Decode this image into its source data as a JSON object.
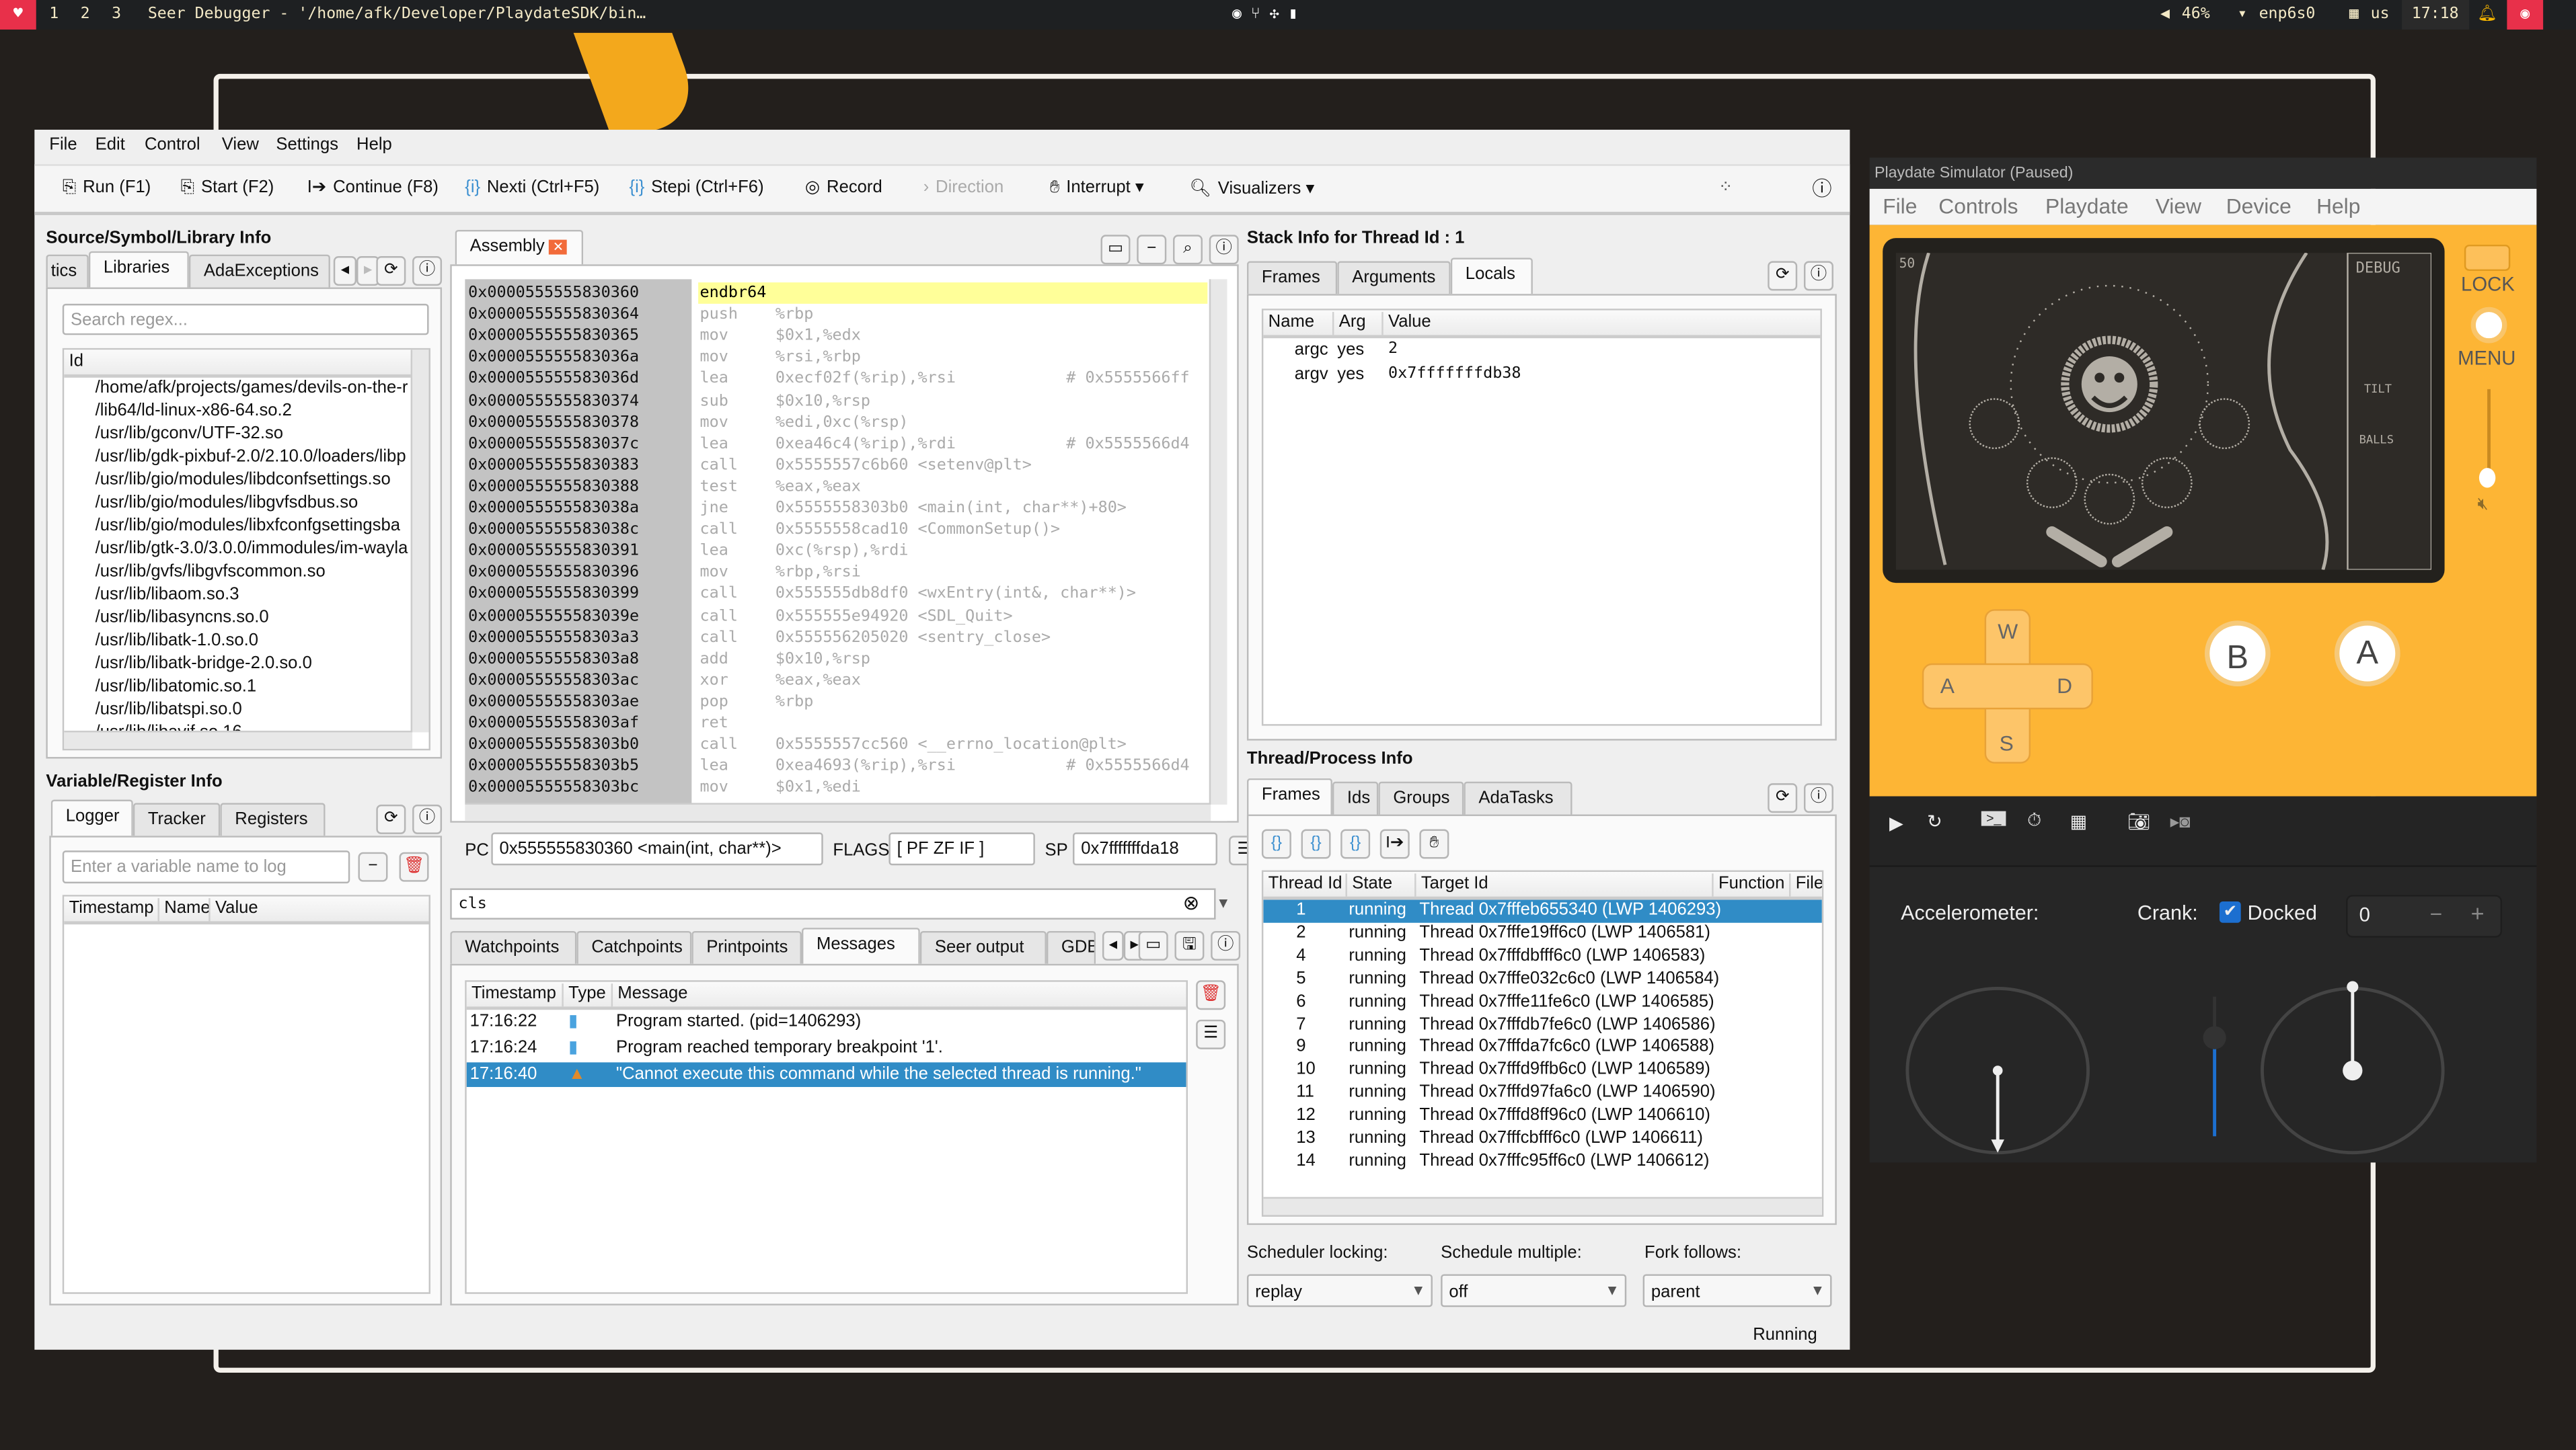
{
  "taskbar": {
    "workspaces": [
      "1",
      "2",
      "3"
    ],
    "window_title": "Seer Debugger - '/home/afk/Developer/PlaydateSDK/bin…",
    "volume": "46%",
    "network": "enp6s0",
    "keyboard_layout": "us",
    "clock": "17:18"
  },
  "seer": {
    "menu": [
      "File",
      "Edit",
      "Control",
      "View",
      "Settings",
      "Help"
    ],
    "toolbar": {
      "run": "Run (F1)",
      "start": "Start (F2)",
      "continue": "Continue (F8)",
      "nexti": "Nexti (Ctrl+F5)",
      "stepi": "Stepi (Ctrl+F6)",
      "record": "Record",
      "direction": "Direction",
      "interrupt": "Interrupt",
      "visualizers": "Visualizers"
    },
    "source_panel": {
      "title": "Source/Symbol/Library Info",
      "tabs": [
        "tics",
        "Libraries",
        "AdaExceptions"
      ],
      "active_tab": "Libraries",
      "search_placeholder": "Search regex...",
      "column": "Id",
      "libraries": [
        "/home/afk/projects/games/devils-on-the-r",
        "/lib64/ld-linux-x86-64.so.2",
        "/usr/lib/gconv/UTF-32.so",
        "/usr/lib/gdk-pixbuf-2.0/2.10.0/loaders/libp",
        "/usr/lib/gio/modules/libdconfsettings.so",
        "/usr/lib/gio/modules/libgvfsdbus.so",
        "/usr/lib/gio/modules/libxfconfgsettingsba",
        "/usr/lib/gtk-3.0/3.0.0/immodules/im-wayla",
        "/usr/lib/gvfs/libgvfscommon.so",
        "/usr/lib/libaom.so.3",
        "/usr/lib/libasyncns.so.0",
        "/usr/lib/libatk-1.0.so.0",
        "/usr/lib/libatk-bridge-2.0.so.0",
        "/usr/lib/libatomic.so.1",
        "/usr/lib/libatspi.so.0",
        "/usr/lib/libavif.so.16"
      ]
    },
    "variable_panel": {
      "title": "Variable/Register Info",
      "tabs": [
        "Logger",
        "Tracker",
        "Registers"
      ],
      "active_tab": "Logger",
      "input_placeholder": "Enter a variable name to log",
      "columns": [
        "Timestamp",
        "Name",
        "Value"
      ]
    },
    "assembly": {
      "tab": "Assembly",
      "rows": [
        {
          "addr": "0x0000555555830360",
          "op": "endbr64",
          "args": "",
          "comment": ""
        },
        {
          "addr": "0x0000555555830364",
          "op": "push",
          "args": "%rbp",
          "comment": ""
        },
        {
          "addr": "0x0000555555830365",
          "op": "mov",
          "args": "$0x1,%edx",
          "comment": ""
        },
        {
          "addr": "0x000055555583036a",
          "op": "mov",
          "args": "%rsi,%rbp",
          "comment": ""
        },
        {
          "addr": "0x000055555583036d",
          "op": "lea",
          "args": "0xecf02f(%rip),%rsi",
          "comment": "# 0x5555566ff"
        },
        {
          "addr": "0x0000555555830374",
          "op": "sub",
          "args": "$0x10,%rsp",
          "comment": ""
        },
        {
          "addr": "0x0000555555830378",
          "op": "mov",
          "args": "%edi,0xc(%rsp)",
          "comment": ""
        },
        {
          "addr": "0x000055555583037c",
          "op": "lea",
          "args": "0xea46c4(%rip),%rdi",
          "comment": "# 0x5555566d4"
        },
        {
          "addr": "0x0000555555830383",
          "op": "call",
          "args": "0x5555557c6b60 <setenv@plt>",
          "comment": ""
        },
        {
          "addr": "0x0000555555830388",
          "op": "test",
          "args": "%eax,%eax",
          "comment": ""
        },
        {
          "addr": "0x000055555583038a",
          "op": "jne",
          "args": "0x5555558303b0 <main(int, char**)+80>",
          "comment": ""
        },
        {
          "addr": "0x000055555583038c",
          "op": "call",
          "args": "0x5555558cad10 <CommonSetup()>",
          "comment": ""
        },
        {
          "addr": "0x0000555555830391",
          "op": "lea",
          "args": "0xc(%rsp),%rdi",
          "comment": ""
        },
        {
          "addr": "0x0000555555830396",
          "op": "mov",
          "args": "%rbp,%rsi",
          "comment": ""
        },
        {
          "addr": "0x0000555555830399",
          "op": "call",
          "args": "0x555555db8df0 <wxEntry(int&, char**)>",
          "comment": ""
        },
        {
          "addr": "0x000055555583039e",
          "op": "call",
          "args": "0x555555e94920 <SDL_Quit>",
          "comment": ""
        },
        {
          "addr": "0x00005555558303a3",
          "op": "call",
          "args": "0x555556205020 <sentry_close>",
          "comment": ""
        },
        {
          "addr": "0x00005555558303a8",
          "op": "add",
          "args": "$0x10,%rsp",
          "comment": ""
        },
        {
          "addr": "0x00005555558303ac",
          "op": "xor",
          "args": "%eax,%eax",
          "comment": ""
        },
        {
          "addr": "0x00005555558303ae",
          "op": "pop",
          "args": "%rbp",
          "comment": ""
        },
        {
          "addr": "0x00005555558303af",
          "op": "ret",
          "args": "",
          "comment": ""
        },
        {
          "addr": "0x00005555558303b0",
          "op": "call",
          "args": "0x5555557cc560 <__errno_location@plt>",
          "comment": ""
        },
        {
          "addr": "0x00005555558303b5",
          "op": "lea",
          "args": "0xea4693(%rip),%rsi",
          "comment": "# 0x5555566d4"
        },
        {
          "addr": "0x00005555558303bc",
          "op": "mov",
          "args": "$0x1,%edi",
          "comment": ""
        }
      ],
      "pc_label": "PC",
      "pc": "0x555555830360 <main(int, char**)>",
      "flags_label": "FLAGS",
      "flags": "[ PF ZF IF ]",
      "sp_label": "SP",
      "sp": "0x7fffffffda18"
    },
    "command": {
      "value": "cls"
    },
    "console": {
      "tabs": [
        "Watchpoints",
        "Catchpoints",
        "Printpoints",
        "Messages",
        "Seer output",
        "GDB"
      ],
      "active_tab": "Messages",
      "columns": [
        "Timestamp",
        "Type",
        "Message"
      ],
      "messages": [
        {
          "time": "17:16:22",
          "type": "info",
          "text": "Program started. (pid=1406293)"
        },
        {
          "time": "17:16:24",
          "type": "info",
          "text": "Program reached temporary breakpoint '1'."
        },
        {
          "time": "17:16:40",
          "type": "warning",
          "text": "\"Cannot execute this command while the selected thread is running.\""
        }
      ]
    },
    "stack": {
      "title": "Stack Info for Thread Id : 1",
      "tabs": [
        "Frames",
        "Arguments",
        "Locals"
      ],
      "active_tab": "Locals",
      "columns": [
        "Name",
        "Arg",
        "Value"
      ],
      "rows": [
        {
          "name": "argc",
          "arg": "yes",
          "value": "2"
        },
        {
          "name": "argv",
          "arg": "yes",
          "value": "0x7fffffffdb38"
        }
      ]
    },
    "threads": {
      "title": "Thread/Process Info",
      "tabs": [
        "Frames",
        "Ids",
        "Groups",
        "AdaTasks"
      ],
      "active_tab": "Frames",
      "columns": [
        "Thread Id",
        "State",
        "Target Id",
        "Function",
        "File"
      ],
      "rows": [
        {
          "id": "1",
          "state": "running",
          "target": "Thread 0x7fffeb655340 (LWP 1406293)"
        },
        {
          "id": "2",
          "state": "running",
          "target": "Thread 0x7fffe19ff6c0 (LWP 1406581)"
        },
        {
          "id": "4",
          "state": "running",
          "target": "Thread 0x7fffdbfff6c0 (LWP 1406583)"
        },
        {
          "id": "5",
          "state": "running",
          "target": "Thread 0x7fffe032c6c0 (LWP 1406584)"
        },
        {
          "id": "6",
          "state": "running",
          "target": "Thread 0x7fffe11fe6c0 (LWP 1406585)"
        },
        {
          "id": "7",
          "state": "running",
          "target": "Thread 0x7fffdb7fe6c0 (LWP 1406586)"
        },
        {
          "id": "9",
          "state": "running",
          "target": "Thread 0x7fffda7fc6c0 (LWP 1406588)"
        },
        {
          "id": "10",
          "state": "running",
          "target": "Thread 0x7fffd9ffb6c0 (LWP 1406589)"
        },
        {
          "id": "11",
          "state": "running",
          "target": "Thread 0x7fffd97fa6c0 (LWP 1406590)"
        },
        {
          "id": "12",
          "state": "running",
          "target": "Thread 0x7fffd8ff96c0 (LWP 1406610)"
        },
        {
          "id": "13",
          "state": "running",
          "target": "Thread 0x7fffcbfff6c0 (LWP 1406611)"
        },
        {
          "id": "14",
          "state": "running",
          "target": "Thread 0x7fffc95ff6c0 (LWP 1406612)"
        }
      ],
      "scheduler_locking_label": "Scheduler locking:",
      "scheduler_locking": "replay",
      "schedule_multiple_label": "Schedule multiple:",
      "schedule_multiple": "off",
      "fork_follows_label": "Fork follows:",
      "fork_follows": "parent"
    },
    "status": "Running"
  },
  "playdate": {
    "title": "Playdate Simulator (Paused)",
    "menu": [
      "File",
      "Controls",
      "Playdate",
      "View",
      "Device",
      "Help"
    ],
    "lock_label": "LOCK",
    "menu_label": "MENU",
    "dpad": {
      "up": "W",
      "left": "A",
      "right": "D",
      "down": "S"
    },
    "b_button": "B",
    "a_button": "A",
    "accelerometer_label": "Accelerometer:",
    "crank_label": "Crank:",
    "docked_label": "Docked",
    "docked": true,
    "crank_angle": "0",
    "colors": {
      "body": "#fdb535",
      "screen": "#2e2b27",
      "panel": "#262626"
    }
  },
  "colors": {
    "selection": "#308cc6",
    "current_line": "#ffff99",
    "taskbar": "#1e2022"
  }
}
